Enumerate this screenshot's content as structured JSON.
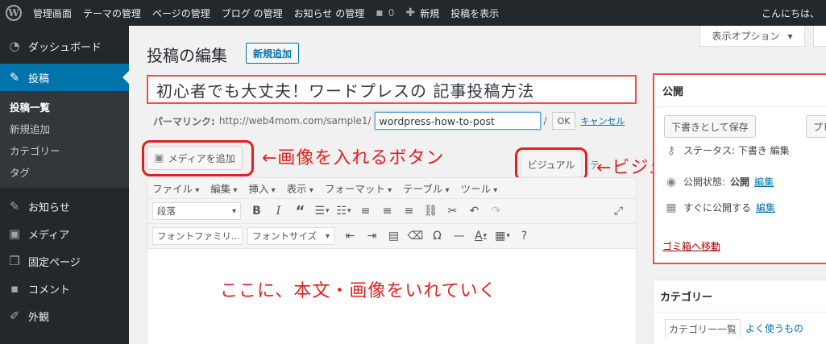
{
  "adminbar": {
    "wp_logo": "W",
    "items": [
      "管理画面",
      "テーマの管理",
      "ページの管理",
      "ブログ の管理",
      "お知らせ の管理"
    ],
    "comments_count": "0",
    "new_label": "新規",
    "view_post": "投稿を表示",
    "greeting": "こんにちは、"
  },
  "sidebar": {
    "dashboard": "ダッシュボード",
    "posts": "投稿",
    "sub": [
      "投稿一覧",
      "新規追加",
      "カテゴリー",
      "タグ"
    ],
    "news": "お知らせ",
    "media": "メディア",
    "pages": "固定ページ",
    "comments": "コメント",
    "appearance": "外観"
  },
  "header": {
    "screen_options": "表示オプション",
    "title": "投稿の編集",
    "add_new": "新規追加"
  },
  "post": {
    "title": "初心者でも大丈夫！ワードプレスの 記事投稿方法",
    "permalink_label": "パーマリンク:",
    "permalink_base": "http://web4mom.com/sample1/",
    "slug": "wordpress-how-to-post",
    "slug_suffix": "/",
    "ok": "OK",
    "cancel": "キャンセル"
  },
  "editor": {
    "add_media": "メディアを追加",
    "visual_tab": "ビジュアル",
    "text_tab": "テ",
    "menus": [
      "ファイル",
      "編集",
      "挿入",
      "表示",
      "フォーマット",
      "テーブル",
      "ツール"
    ],
    "format_select": "段落",
    "font_family": "フォントファミリ...",
    "font_size": "フォントサイズ"
  },
  "annotations": {
    "media": "←画像を入れるボタン",
    "visual": "←ビジュアルを選択",
    "body": "ここに、本文・画像をいれていく"
  },
  "publish": {
    "title": "公開",
    "save_draft": "下書きとして保存",
    "preview": "プレ",
    "status_partial": "ステータス: 下書き 編集",
    "visibility_label": "公開状態:",
    "visibility_value": "公開",
    "visibility_edit": "編集",
    "schedule_label": "すぐに公開する",
    "schedule_edit": "編集",
    "trash": "ゴミ箱へ移動"
  },
  "categories": {
    "title": "カテゴリー",
    "tab_all": "カテゴリー一覧",
    "tab_popular": "よく使うもの"
  },
  "colors": {
    "accent": "#0073aa",
    "annotation_red": "#e02020",
    "adminbar": "#23282d"
  }
}
